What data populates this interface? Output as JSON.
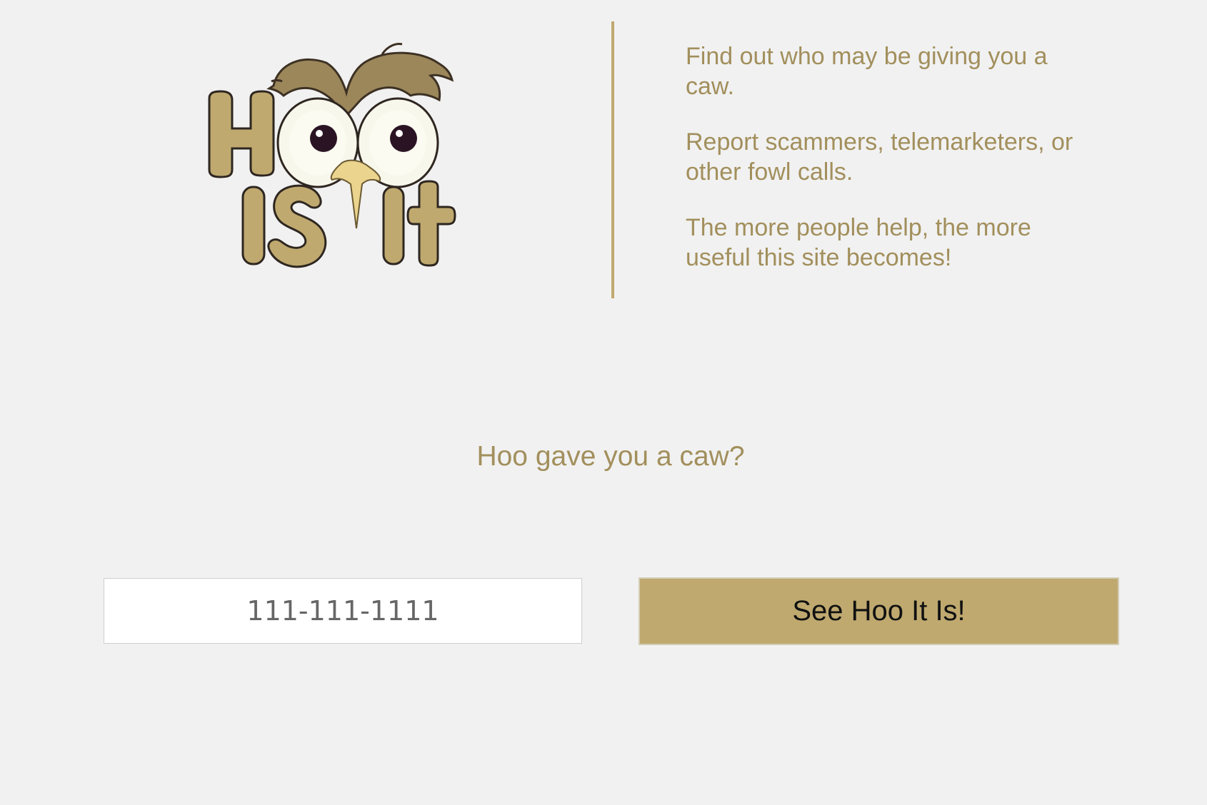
{
  "logo": {
    "text_line1": "Hoo",
    "text_line2": "Is It"
  },
  "intro": {
    "paragraphs": [
      "Find out who may be giving you a caw.",
      "Report scammers, telemarketers, or other fowl calls.",
      "The more people help, the more useful this site becomes!"
    ]
  },
  "search": {
    "question": "Hoo gave you a caw?",
    "phone_placeholder": "111-111-1111",
    "phone_value": "",
    "button_label": "See Hoo It Is!"
  },
  "colors": {
    "background": "#f1f1f1",
    "accent_gold": "#bfa96f",
    "text_gold": "#a28f5c",
    "owl_brown": "#9b875a"
  }
}
